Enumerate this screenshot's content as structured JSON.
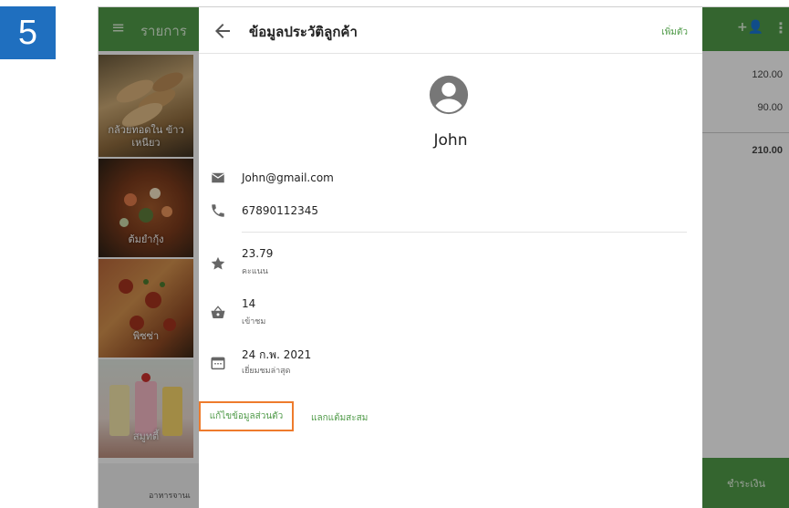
{
  "step_number": "5",
  "background": {
    "header_title": "รายการ",
    "menu_items": [
      {
        "label": "กล้วยทอดใน ข้าวเหนียว"
      },
      {
        "label": "ต้มยำกุ้ง"
      },
      {
        "label": "พิซซ่า"
      },
      {
        "label": "สมูทตี้"
      }
    ],
    "category_label": "อาหารจานเ",
    "amounts": [
      "120.00",
      "90.00"
    ],
    "total": "210.00",
    "pay_label": "ชำระเงิน"
  },
  "dialog": {
    "title": "ข้อมูลประวัติลูกค้า",
    "header_action": "เพิ่มตัว",
    "customer_name": "John",
    "email": "John@gmail.com",
    "phone": "67890112345",
    "points_value": "23.79",
    "points_label": "คะแนน",
    "visits_value": "14",
    "visits_label": "เข้าชม",
    "last_visit_value": "24 ก.พ. 2021",
    "last_visit_label": "เยี่ยมชมล่าสุด",
    "edit_button": "แก้ไขข้อมูลส่วนตัว",
    "redeem_button": "แลกแต้มสะสม"
  },
  "colors": {
    "accent_green": "#4f9a48",
    "highlight_orange": "#ee7b2c",
    "step_badge_blue": "#1f6fbf"
  },
  "icons": [
    "menu-icon",
    "back-arrow-icon",
    "account-circle-icon",
    "email-icon",
    "phone-icon",
    "star-icon",
    "shopping-basket-icon",
    "calendar-icon",
    "add-person-icon",
    "more-vert-icon"
  ]
}
